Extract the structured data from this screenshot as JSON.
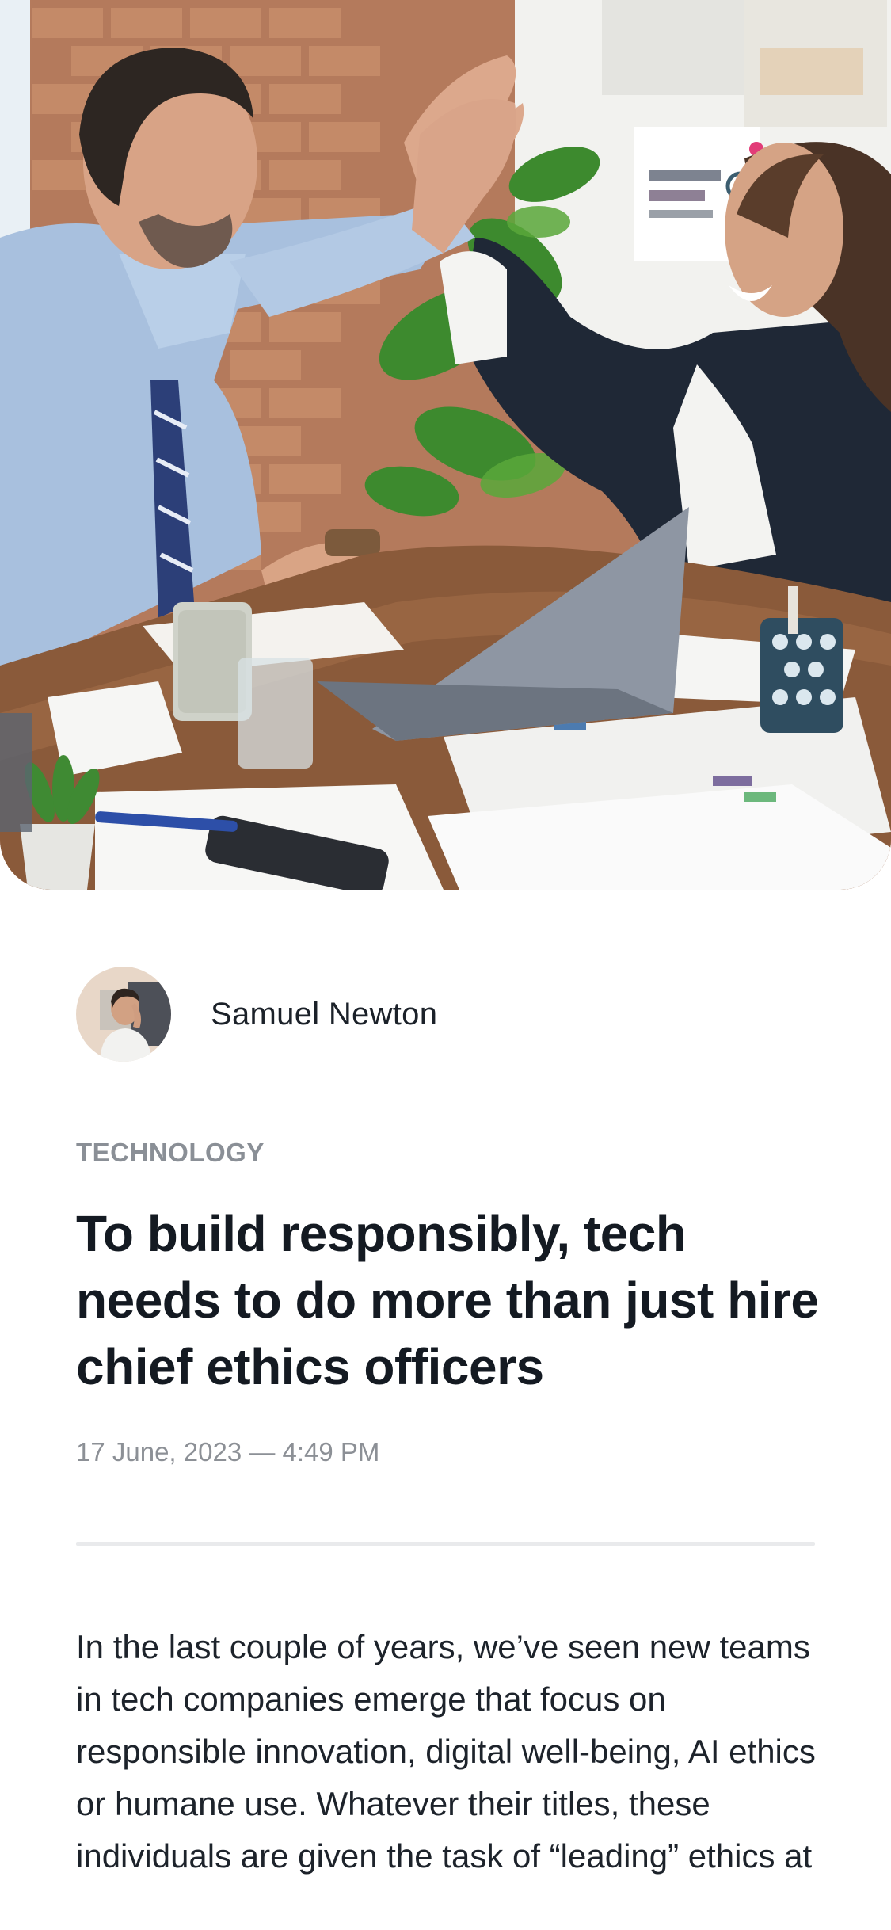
{
  "hero": {
    "image_description": "photo-two-colleagues-high-five"
  },
  "author": {
    "name": "Samuel Newton",
    "avatar_icon": "author-avatar"
  },
  "article": {
    "category": "TECHNOLOGY",
    "title": "To build responsibly, tech needs to do more than just hire chief ethics officers",
    "datetime": "17 June, 2023 — 4:49 PM",
    "body": "In the last couple of years, we’ve seen new teams in tech companies emerge that focus on responsible innovation, digital well-being, AI ethics or humane use. Whatever their titles, these individuals are given the task of “leading” ethics at"
  },
  "colors": {
    "title": "#141a22",
    "category": "#8a8f96",
    "meta": "#8c9096",
    "divider": "#e9eaec",
    "background": "#ffffff"
  }
}
